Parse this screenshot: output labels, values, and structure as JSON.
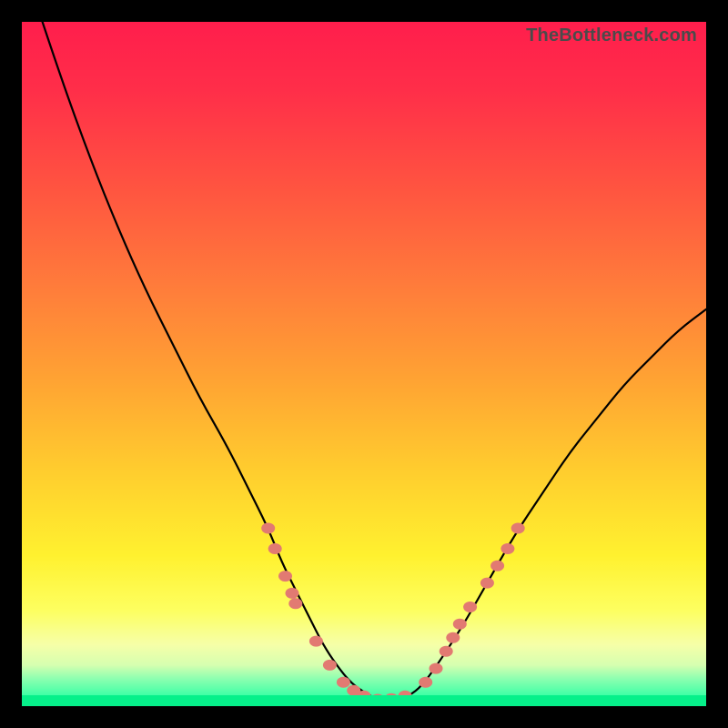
{
  "brand": "TheBottleneck.com",
  "colors": {
    "frame": "#000000",
    "curve_stroke": "#000000",
    "marker_fill": "#e27a72",
    "marker_stroke": "#c05a54",
    "gradient_top": "#ff1e4c",
    "gradient_bottom": "#06e87a"
  },
  "chart_data": {
    "type": "line",
    "title": "",
    "xlabel": "",
    "ylabel": "",
    "xlim": [
      0,
      100
    ],
    "ylim": [
      0,
      100
    ],
    "grid": false,
    "legend": false,
    "annotations": [],
    "series": [
      {
        "name": "bottleneck-curve",
        "x": [
          3,
          6,
          10,
          14,
          18,
          22,
          26,
          30,
          33,
          36,
          38,
          40,
          42,
          44,
          46,
          48,
          50,
          52,
          54,
          56,
          58,
          60,
          64,
          68,
          72,
          76,
          80,
          84,
          88,
          92,
          96,
          100
        ],
        "y": [
          100,
          91,
          80,
          70,
          61,
          53,
          45,
          38,
          32,
          26,
          21,
          17,
          13,
          9,
          6,
          3.5,
          2,
          1,
          1,
          1.2,
          2.5,
          5,
          11,
          18,
          25,
          31,
          37,
          42,
          47,
          51,
          55,
          58
        ]
      }
    ],
    "markers": {
      "name": "highlight-dots",
      "points": [
        {
          "x": 36,
          "y": 26
        },
        {
          "x": 37,
          "y": 23
        },
        {
          "x": 38.5,
          "y": 19
        },
        {
          "x": 39.5,
          "y": 16.5
        },
        {
          "x": 40,
          "y": 15
        },
        {
          "x": 43,
          "y": 9.5
        },
        {
          "x": 45,
          "y": 6
        },
        {
          "x": 47,
          "y": 3.5
        },
        {
          "x": 48.5,
          "y": 2.3
        },
        {
          "x": 50,
          "y": 1.5
        },
        {
          "x": 52,
          "y": 1
        },
        {
          "x": 54,
          "y": 1.1
        },
        {
          "x": 56,
          "y": 1.5
        },
        {
          "x": 59,
          "y": 3.5
        },
        {
          "x": 60.5,
          "y": 5.5
        },
        {
          "x": 62,
          "y": 8
        },
        {
          "x": 63,
          "y": 10
        },
        {
          "x": 64,
          "y": 12
        },
        {
          "x": 65.5,
          "y": 14.5
        },
        {
          "x": 68,
          "y": 18
        },
        {
          "x": 69.5,
          "y": 20.5
        },
        {
          "x": 71,
          "y": 23
        },
        {
          "x": 72.5,
          "y": 26
        }
      ]
    }
  }
}
